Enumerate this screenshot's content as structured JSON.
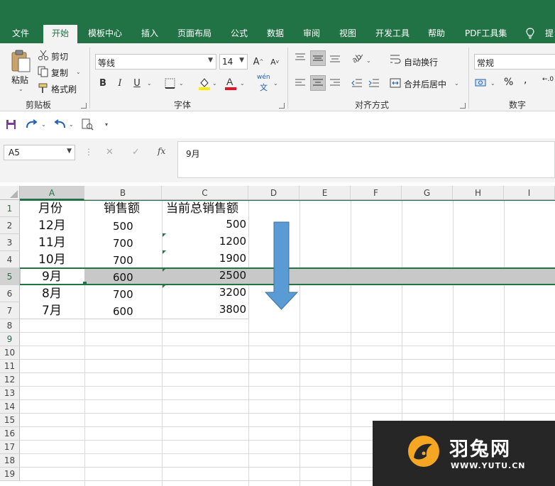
{
  "ribbon_tabs": [
    {
      "label": "文件"
    },
    {
      "label": "开始"
    },
    {
      "label": "模板中心"
    },
    {
      "label": "插入"
    },
    {
      "label": "页面布局"
    },
    {
      "label": "公式"
    },
    {
      "label": "数据"
    },
    {
      "label": "审阅"
    },
    {
      "label": "视图"
    },
    {
      "label": "开发工具"
    },
    {
      "label": "帮助"
    },
    {
      "label": "PDF工具集"
    },
    {
      "label": "提"
    }
  ],
  "clipboard": {
    "paste": "粘贴",
    "cut": "剪切",
    "copy": "复制",
    "painter": "格式刷",
    "group": "剪贴板"
  },
  "font": {
    "name": "等线",
    "size": "14",
    "bold": "B",
    "italic": "I",
    "underline": "U",
    "wen": "wén",
    "wen2": "文",
    "group": "字体"
  },
  "alignment": {
    "wrap": "自动换行",
    "merge": "合并后居中",
    "group": "对齐方式"
  },
  "number": {
    "format": "常规",
    "percent": "%",
    "comma": ",",
    "group": "数字"
  },
  "formula_bar": {
    "name_box": "A5",
    "cancel": "✕",
    "enter": "✓",
    "fx": "fx",
    "content": "9月"
  },
  "columns": [
    "A",
    "B",
    "C",
    "D",
    "E",
    "F",
    "G",
    "H",
    "I"
  ],
  "rows": [
    "1",
    "2",
    "3",
    "4",
    "5",
    "6",
    "7",
    "8",
    "9",
    "10",
    "11",
    "12",
    "13",
    "14",
    "15",
    "16",
    "17",
    "18",
    "19"
  ],
  "table": {
    "headers": [
      "月份",
      "销售额",
      "当前总销售额"
    ],
    "data": [
      [
        "12月",
        "500",
        "500"
      ],
      [
        "11月",
        "700",
        "1200"
      ],
      [
        "10月",
        "700",
        "1900"
      ],
      [
        "9月",
        "600",
        "2500"
      ],
      [
        "8月",
        "700",
        "3200"
      ],
      [
        "7月",
        "600",
        "3800"
      ]
    ]
  },
  "watermark": {
    "title": "羽兔网",
    "url": "WWW.YUTU.CN"
  },
  "colors": {
    "excel_green": "#217346",
    "arrow_blue": "#5b9bd5",
    "selection_gray": "#c8c8c8"
  }
}
